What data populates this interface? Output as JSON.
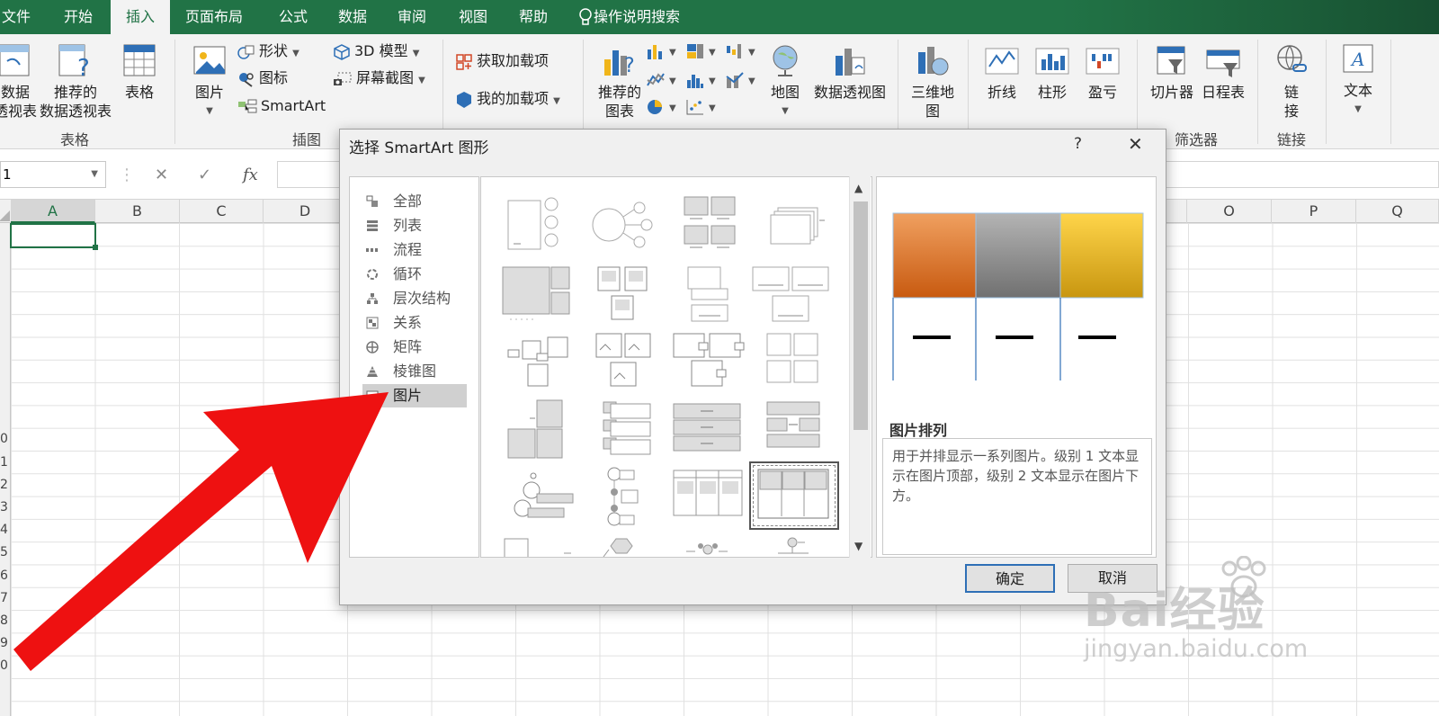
{
  "ribbon_tabs": [
    "文件",
    "开始",
    "插入",
    "页面布局",
    "公式",
    "数据",
    "审阅",
    "视图",
    "帮助"
  ],
  "active_tab": "插入",
  "tell_me": "操作说明搜索",
  "ribbon": {
    "pivot_table": "数据\n透视表",
    "recommended_pivot": "推荐的\n数据透视表",
    "table": "表格",
    "group_tables": "表格",
    "pictures": "图片",
    "shapes": "形状",
    "icons": "图标",
    "smartart": "SmartArt",
    "model3d": "3D 模型",
    "screenshot": "屏幕截图",
    "group_illustrations": "插图",
    "get_addins": "获取加载项",
    "my_addins": "我的加载项",
    "recommended_charts": "推荐的\n图表",
    "maps": "地图",
    "pivot_chart": "数据透视图",
    "map3d": "三维地\n图",
    "sparkline_line": "折线",
    "sparkline_column": "柱形",
    "sparkline_winloss": "盈亏",
    "slicer": "切片器",
    "timeline": "日程表",
    "group_filters": "筛选器",
    "link": "链\n接",
    "group_links": "链接",
    "text": "文本"
  },
  "formula_bar": {
    "name_box": "1",
    "fx": "fx",
    "cancel": "✕",
    "enter": "✓"
  },
  "columns": [
    "A",
    "B",
    "C",
    "D",
    "O",
    "P",
    "Q"
  ],
  "row_numbers": [
    "0",
    "1",
    "2",
    "3",
    "4",
    "5",
    "6",
    "7",
    "8",
    "9",
    "0"
  ],
  "dialog": {
    "title": "选择 SmartArt 图形",
    "help": "?",
    "close": "✕",
    "categories": [
      "全部",
      "列表",
      "流程",
      "循环",
      "层次结构",
      "关系",
      "矩阵",
      "棱锥图",
      "图片"
    ],
    "selected_category": "图片",
    "preview_name": "图片排列",
    "preview_description": "用于并排显示一系列图片。级别 1 文本显示在图片顶部，级别 2 文本显示在图片下方。",
    "ok": "确定",
    "cancel": "取消",
    "preview_colors": [
      "#e2762a",
      "#8c8c8c",
      "#f0b51a"
    ]
  },
  "watermark": {
    "brand": "Bai经验",
    "site": "jingyan.baidu.com"
  },
  "colors": {
    "excel_green": "#217346",
    "arrow_red": "#ee1111"
  }
}
